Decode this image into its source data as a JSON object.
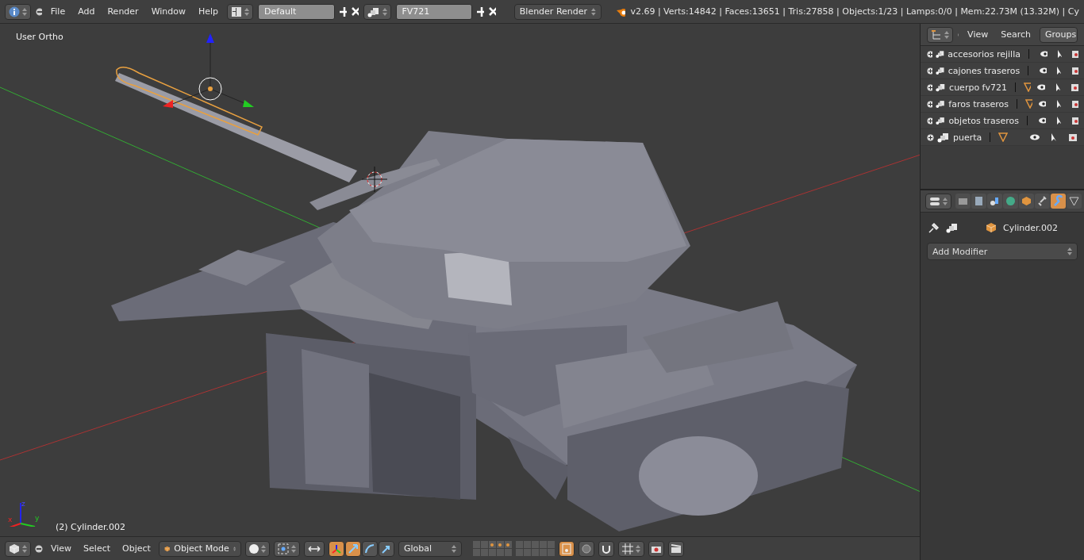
{
  "top_bar": {
    "menus": [
      "File",
      "Add",
      "Render",
      "Window",
      "Help"
    ],
    "layout": "Default",
    "scene": "FV721",
    "engine": "Blender Render",
    "stats": "v2.69 | Verts:14842 | Faces:13651 | Tris:27858 | Objects:1/23 | Lamps:0/0 | Mem:22.73M (13.32M) | Cy"
  },
  "viewport": {
    "view_name": "User Ortho",
    "object_info": "(2) Cylinder.002",
    "axes": [
      "x",
      "y",
      "z"
    ]
  },
  "viewport_header": {
    "menus": [
      "View",
      "Select",
      "Object"
    ],
    "mode": "Object Mode",
    "transform_orientation": "Global",
    "manipulators": [
      {
        "kind": "toggle",
        "selected": true
      },
      {
        "kind": "translate",
        "selected": true
      },
      {
        "kind": "rotate",
        "selected": false
      },
      {
        "kind": "scale",
        "selected": false
      }
    ],
    "layers": [
      {
        "used": false
      },
      {
        "used": false
      },
      {
        "used": true
      },
      {
        "used": true
      },
      {
        "used": true
      },
      {
        "used": false
      },
      {
        "used": false
      },
      {
        "used": false
      },
      {
        "used": false
      },
      {
        "used": false
      },
      {
        "used": false
      },
      {
        "used": false
      },
      {
        "used": false
      },
      {
        "used": false
      },
      {
        "used": false
      },
      {
        "used": false
      },
      {
        "used": false
      },
      {
        "used": false
      },
      {
        "used": false
      },
      {
        "used": false
      }
    ],
    "lock_camera": {
      "on": true
    }
  },
  "outliner": {
    "menus": [
      "View",
      "Search"
    ],
    "display_mode": "Groups",
    "groups": [
      {
        "name": "accesorios rejilla",
        "mesh_data": false
      },
      {
        "name": "cajones traseros",
        "mesh_data": false
      },
      {
        "name": "cuerpo fv721",
        "mesh_data": true
      },
      {
        "name": "faros traseros",
        "mesh_data": true
      },
      {
        "name": "objetos traseros",
        "mesh_data": false
      },
      {
        "name": "puerta",
        "mesh_data": true
      }
    ]
  },
  "properties": {
    "tabs": [
      {
        "kind": "render",
        "selected": false
      },
      {
        "kind": "layers",
        "selected": false
      },
      {
        "kind": "scene",
        "selected": false
      },
      {
        "kind": "world",
        "selected": false
      },
      {
        "kind": "object",
        "selected": false
      },
      {
        "kind": "constraints",
        "selected": false
      },
      {
        "kind": "modifiers",
        "selected": true
      },
      {
        "kind": "data",
        "selected": false
      }
    ],
    "object_name": "Cylinder.002",
    "add_button": "Add Modifier"
  }
}
